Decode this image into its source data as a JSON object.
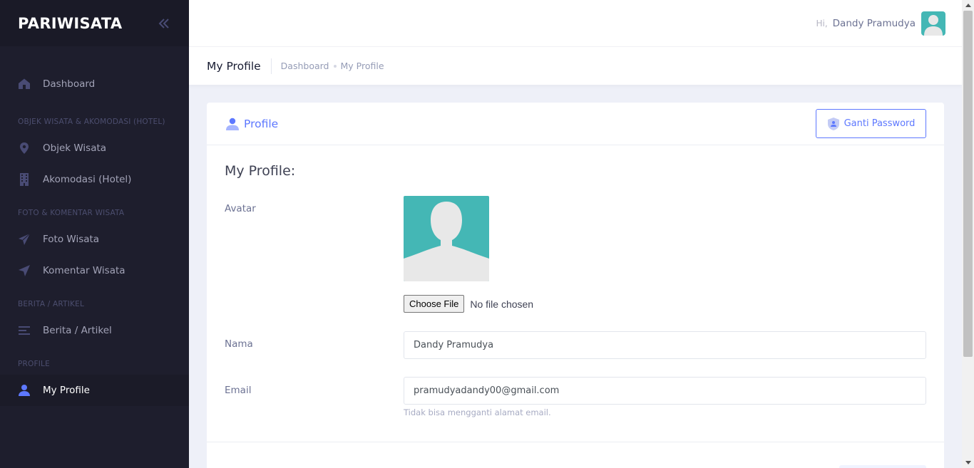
{
  "brand": {
    "name": "PARIWISATA"
  },
  "sidebar": {
    "items": [
      {
        "label": "Dashboard"
      },
      {
        "section": "OBJEK WISATA & AKOMODASI (HOTEL)"
      },
      {
        "label": "Objek Wisata"
      },
      {
        "label": "Akomodasi (Hotel)"
      },
      {
        "section": "FOTO & KOMENTAR WISATA"
      },
      {
        "label": "Foto Wisata"
      },
      {
        "label": "Komentar Wisata"
      },
      {
        "section": "BERITA / ARTIKEL"
      },
      {
        "label": "Berita / Artikel"
      },
      {
        "section": "PROFILE"
      },
      {
        "label": "My Profile"
      }
    ]
  },
  "header": {
    "greeting": "Hi,",
    "user_name": "Dandy Pramudya"
  },
  "subheader": {
    "title": "My Profile",
    "breadcrumb": [
      "Dashboard",
      "My Profile"
    ]
  },
  "card": {
    "title": "Profile",
    "change_password_label": "Ganti Password",
    "form_title": "My Profile:",
    "avatar_label": "Avatar",
    "file_button_label": "Choose File",
    "file_status": "No file chosen",
    "name_label": "Nama",
    "name_value": "Dandy Pramudya",
    "email_label": "Email",
    "email_value": "pramudyadandy00@gmail.com",
    "email_hint": "Tidak bisa mengganti alamat email."
  },
  "colors": {
    "sidebar_bg": "#1e1e2d",
    "accent": "#5d78ff",
    "avatar_bg": "#44b7b5"
  }
}
